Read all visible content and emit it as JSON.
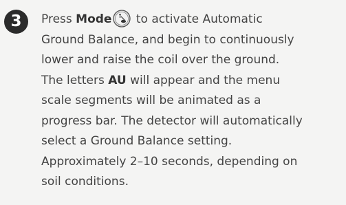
{
  "step": {
    "number": "3",
    "lines": [
      {
        "pre": "Press ",
        "bold": "Mode",
        "post": " to activate Automatic",
        "icon": "mode-button-icon"
      },
      {
        "text": "Ground Balance, and begin to continuously"
      },
      {
        "text": "lower and raise the coil over the ground."
      },
      {
        "pre": "The letters ",
        "bold": "AU",
        "post": " will appear and the menu"
      },
      {
        "text": "scale segments will be animated as a"
      },
      {
        "text": "progress bar. The detector will automatically"
      },
      {
        "text": "select a Ground Balance setting."
      },
      {
        "text": "Approximately 2–10 seconds, depending on"
      },
      {
        "text": "soil conditions."
      }
    ]
  }
}
